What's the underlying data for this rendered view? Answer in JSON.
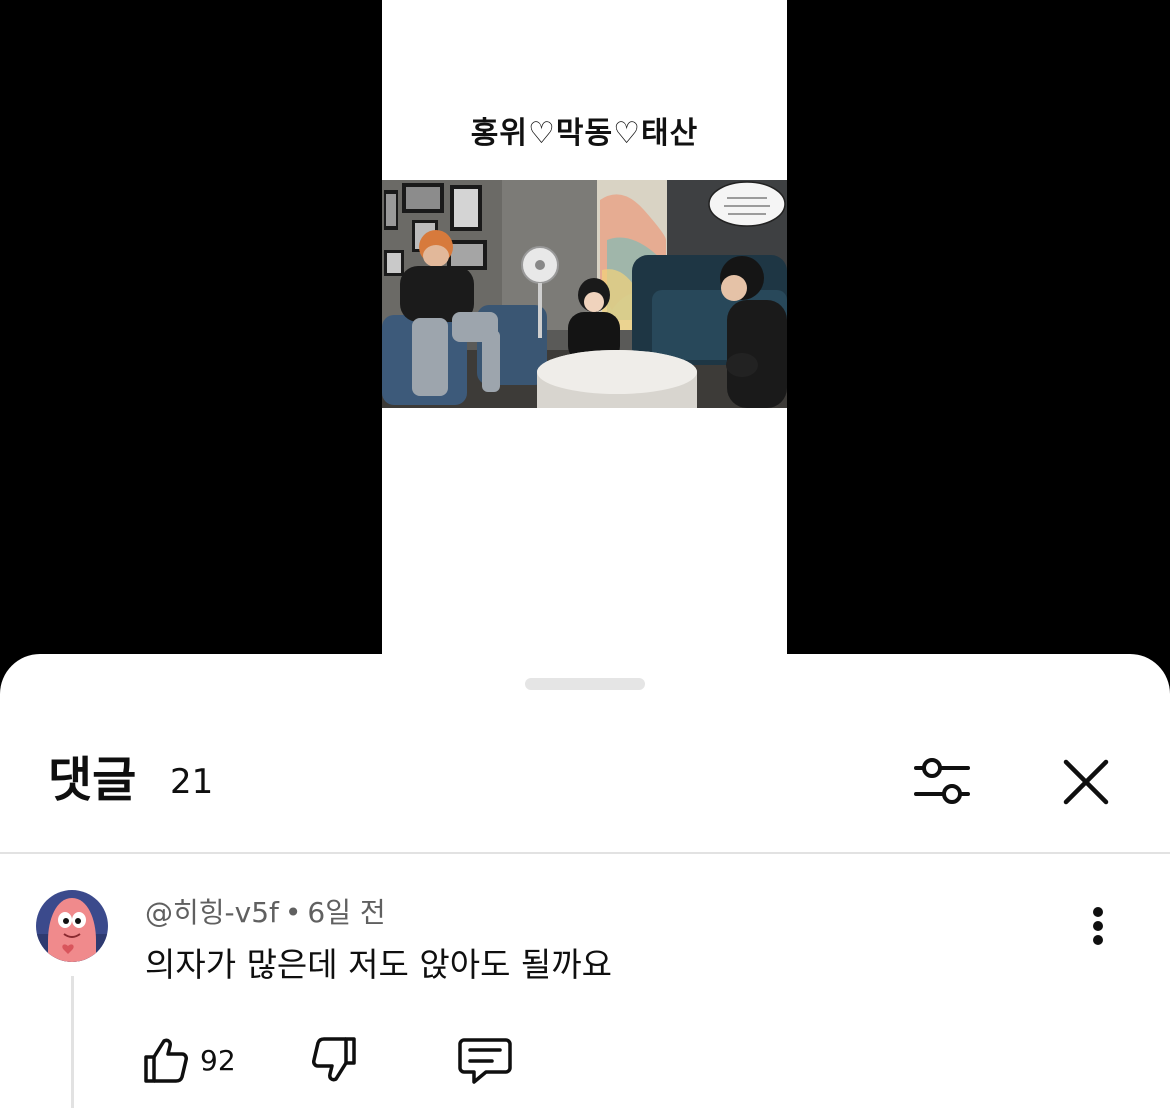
{
  "video": {
    "caption": "홍위♡막동♡태산",
    "watermark": "",
    "scene_sign": ""
  },
  "comments_sheet": {
    "title": "댓글",
    "count": "21"
  },
  "comments": [
    {
      "author": "@히힝-v5f",
      "separator": "•",
      "time": "6일 전",
      "text": "의자가 많은데 저도 앉아도 될까요",
      "likes": "92"
    }
  ],
  "icons": {
    "filter": "sliders-icon",
    "close": "close-icon",
    "more": "more-vertical-icon",
    "like": "thumbs-up-icon",
    "dislike": "thumbs-down-icon",
    "reply": "reply-comment-icon"
  }
}
